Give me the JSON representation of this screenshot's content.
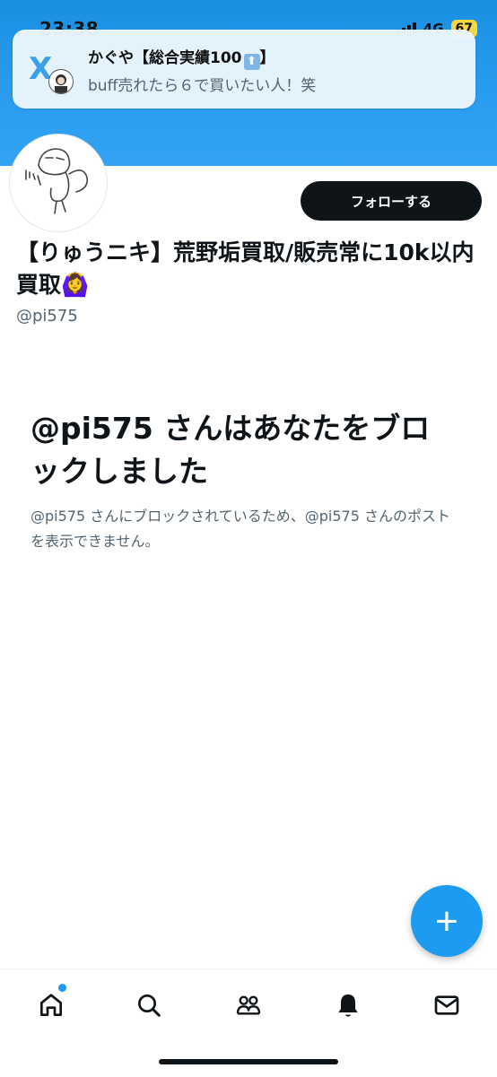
{
  "status_bar": {
    "time": "23:38",
    "network": "4G",
    "battery": "67"
  },
  "notification": {
    "app_icon": "x-logo",
    "title": "かぐや【総合実績100",
    "title_suffix": "】",
    "body": "buff売れたら６で買いたい人！笑"
  },
  "profile": {
    "display_name": "【りゅうニキ】荒野垢買取/販売常に10k以内買取🙆‍♀️",
    "handle": "@pi575",
    "follow_label": "フォローする"
  },
  "blocked": {
    "title": "@pi575 さんはあなたをブロックしました",
    "description": "@pi575 さんにブロックされているため、@pi575 さんのポストを表示できません。"
  },
  "fab": {
    "icon": "plus-icon"
  },
  "bottom_nav": {
    "items": [
      {
        "name": "home",
        "icon": "home-icon",
        "has_badge": true
      },
      {
        "name": "search",
        "icon": "search-icon"
      },
      {
        "name": "communities",
        "icon": "communities-icon"
      },
      {
        "name": "notifications",
        "icon": "bell-icon"
      },
      {
        "name": "messages",
        "icon": "mail-icon"
      }
    ]
  },
  "colors": {
    "accent": "#1d9bf0",
    "banner": "#2b9df0",
    "text_primary": "#0f1419",
    "text_secondary": "#536471",
    "battery_badge": "#f6d642"
  }
}
